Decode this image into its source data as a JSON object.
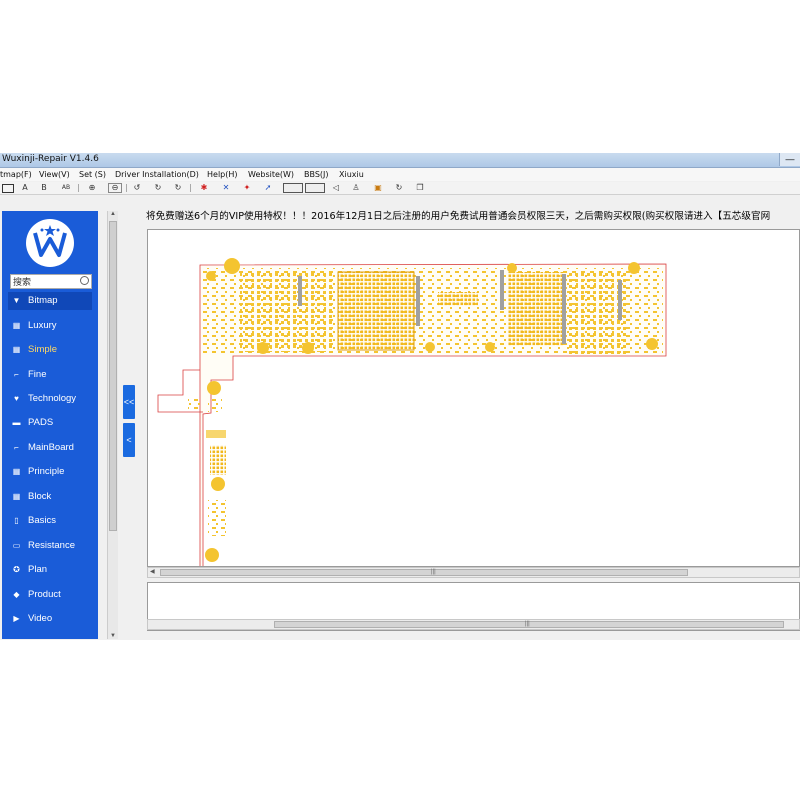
{
  "window": {
    "title": "Wuxinji-Repair V1.4.6"
  },
  "menu": [
    "tmap(F)",
    "View(V)",
    "Set (S)",
    "Driver Installation(D)",
    "Help(H)",
    "Website(W)",
    "BBS(J)",
    "Xiuxiu"
  ],
  "toolbar": {
    "letter_a": "A",
    "letter_b": "B",
    "ab": "AB"
  },
  "sidebar": {
    "search_placeholder": "搜索",
    "items": [
      {
        "label": "Bitmap",
        "icon": "triangle-down-icon"
      },
      {
        "label": "Luxury",
        "icon": "grid-icon"
      },
      {
        "label": "Simple",
        "icon": "grid-icon"
      },
      {
        "label": "Fine",
        "icon": "bracket-icon"
      },
      {
        "label": "Technology",
        "icon": "heart-icon"
      },
      {
        "label": "PADS",
        "icon": "chat-icon"
      },
      {
        "label": "MainBoard",
        "icon": "bracket-icon"
      },
      {
        "label": "Principle",
        "icon": "grid-icon"
      },
      {
        "label": "Block",
        "icon": "grid-icon"
      },
      {
        "label": "Basics",
        "icon": "phone-icon"
      },
      {
        "label": "Resistance",
        "icon": "rectangle-icon"
      },
      {
        "label": "Plan",
        "icon": "compass-icon"
      },
      {
        "label": "Product",
        "icon": "cube-icon"
      },
      {
        "label": "Video",
        "icon": "video-icon"
      }
    ],
    "active_item": "Bitmap"
  },
  "collapse_buttons": [
    "<<",
    "<"
  ],
  "notice": "将免费赠送6个月的VIP使用特权！！！2016年12月1日之后注册的用户免费试用普通会员权限三天，之后需购买权限(购买权限请进入【五芯级官网",
  "colors": {
    "sidebar": "#1a5cd8",
    "board_fill": "#f4c430",
    "board_outline": "#d94040"
  }
}
